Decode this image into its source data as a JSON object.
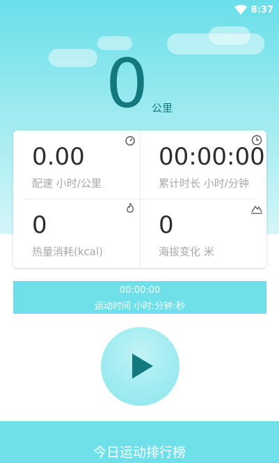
{
  "status_bar": {
    "time": "8:37",
    "wifi_icon": "wifi-icon"
  },
  "distance": {
    "value": "0",
    "unit": "公里"
  },
  "stats": [
    {
      "value": "0.00",
      "label": "配速  小时/公里",
      "icon": "speedometer-icon"
    },
    {
      "value": "00:00:00",
      "label": "累计时长  小时/分钟",
      "icon": "clock-icon"
    },
    {
      "value": "0",
      "label": "热量消耗(kcal)",
      "icon": "flame-icon"
    },
    {
      "value": "0",
      "label": "海拔变化 米",
      "icon": "mountain-icon"
    }
  ],
  "timer": {
    "value": "00:00:00",
    "label": "运动时间 小时:分钟:秒"
  },
  "play_icon": "play-icon",
  "ranking_button": "今日运动排行榜",
  "colors": {
    "primary": "#6fe0ea",
    "accent_text": "#13797f",
    "label_gray": "#a8a8a8"
  }
}
